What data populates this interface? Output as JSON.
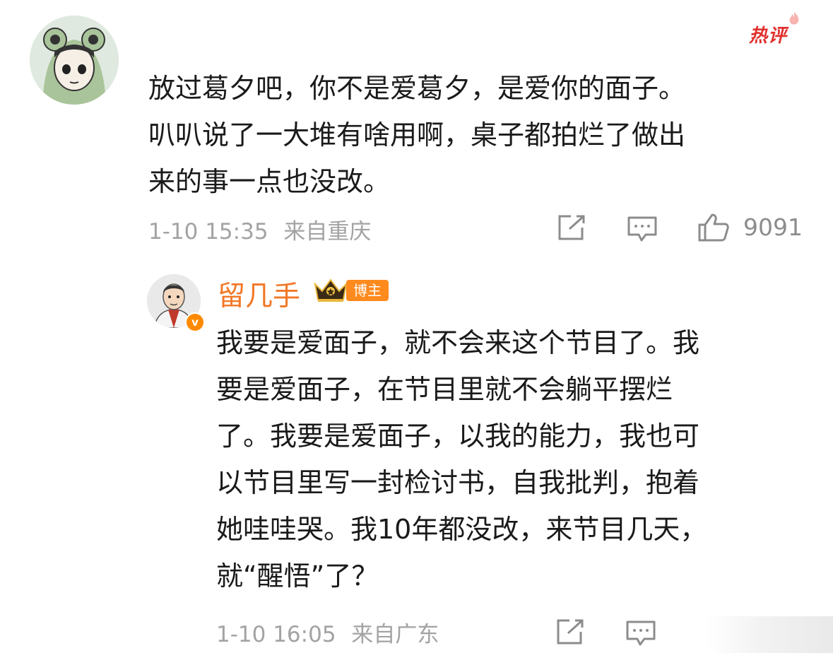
{
  "hot_badge": "热评",
  "comment": {
    "lines": [
      "放过葛夕吧，你不是爱葛夕，是爱你的面子。",
      "叭叭说了一大堆有啥用啊，桌子都拍烂了做出",
      "来的事一点也没改。"
    ],
    "time": "1-10 15:35",
    "location": "来自重庆",
    "like_count": "9091",
    "icons": {
      "share": "share-icon",
      "comment": "comment-icon",
      "like": "thumbs-up-icon"
    }
  },
  "reply": {
    "author": "留几手",
    "tag": "博主",
    "verified_mark": "v",
    "lines": [
      "我要是爱面子，就不会来这个节目了。我",
      "要是爱面子，在节目里就不会躺平摆烂",
      "了。我要是爱面子，以我的能力，我也可",
      "以节目里写一封检讨书，自我批判，抱着",
      "她哇哇哭。我10年都没改，来节目几天，",
      "就“醒悟”了？"
    ],
    "time": "1-10 16:05",
    "location": "来自广东",
    "icons": {
      "share": "share-icon",
      "comment": "comment-icon"
    }
  },
  "colors": {
    "hot": "#e0302e",
    "author": "#f27726",
    "meta": "#a3a3a3",
    "text": "#1a1a1a"
  }
}
